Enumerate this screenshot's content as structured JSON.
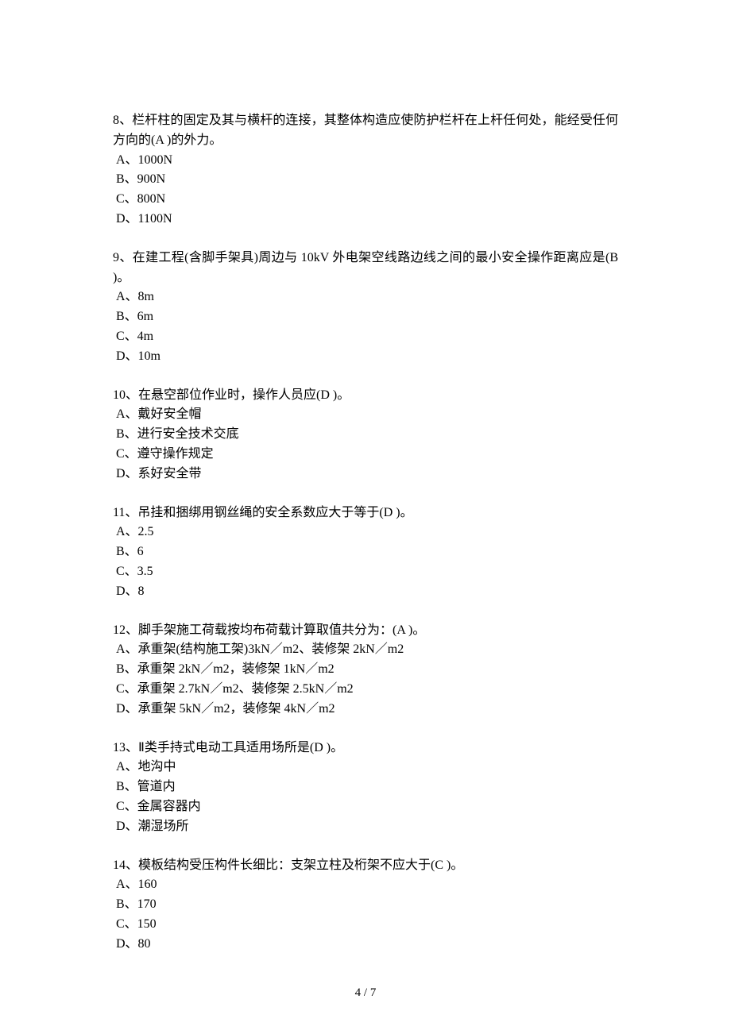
{
  "questions": [
    {
      "stem": "8、栏杆柱的固定及其与横杆的连接，其整体构造应使防护栏杆在上杆任何处，能经受任何方向的(A )的外力。",
      "options": [
        "A、1000N",
        "B、900N",
        "C、800N",
        "D、1100N"
      ]
    },
    {
      "stem": "9、在建工程(含脚手架具)周边与 10kV 外电架空线路边线之间的最小安全操作距离应是(B )。",
      "options": [
        "A、8m",
        "B、6m",
        "C、4m",
        "D、10m"
      ]
    },
    {
      "stem": "10、在悬空部位作业时，操作人员应(D )。",
      "options": [
        "A、戴好安全帽",
        "B、进行安全技术交底",
        "C、遵守操作规定",
        "D、系好安全带"
      ]
    },
    {
      "stem": "11、吊挂和捆绑用钢丝绳的安全系数应大于等于(D )。",
      "options": [
        "A、2.5",
        "B、6",
        "C、3.5",
        "D、8"
      ]
    },
    {
      "stem": "12、脚手架施工荷载按均布荷载计算取值共分为：(A )。",
      "options": [
        "A、承重架(结构施工架)3kN／m2、装修架 2kN／m2",
        "B、承重架 2kN／m2，装修架 1kN／m2",
        "C、承重架 2.7kN／m2、装修架 2.5kN／m2",
        "D、承重架 5kN／m2，装修架 4kN／m2"
      ]
    },
    {
      "stem": "13、Ⅱ类手持式电动工具适用场所是(D )。",
      "options": [
        "A、地沟中",
        "B、管道内",
        "C、金属容器内",
        "D、潮湿场所"
      ]
    },
    {
      "stem": "14、模板结构受压构件长细比：支架立柱及桁架不应大于(C )。",
      "options": [
        "A、160",
        "B、170",
        "C、150",
        "D、80"
      ]
    }
  ],
  "footer": "4 / 7"
}
